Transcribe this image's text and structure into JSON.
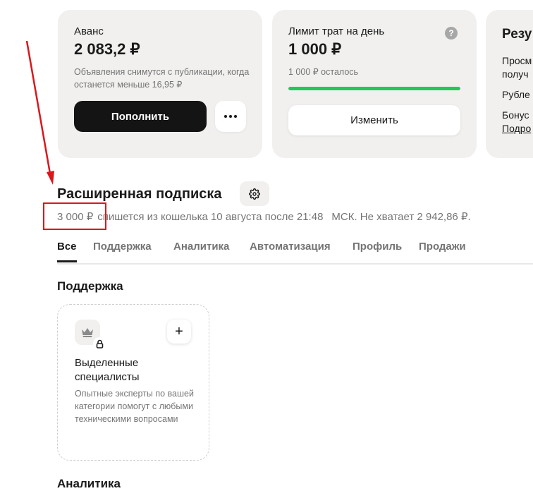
{
  "wallet": {
    "title": "Аванс",
    "amount": "2 083,2 ₽",
    "note": "Объявления снимутся с публикации, когда останется меньше 16,95 ₽",
    "topup_label": "Пополнить",
    "more_icon": "more-dots-icon"
  },
  "daily_limit": {
    "title": "Лимит трат на день",
    "amount": "1 000 ₽",
    "remaining": "1 000 ₽ осталось",
    "progress": 1.0,
    "progress_color": "#1fca55",
    "help_icon": "?",
    "change_label": "Изменить"
  },
  "results": {
    "title": "Резу",
    "line1": "Просм",
    "line2": "получ",
    "line3": "Рубле",
    "line4": "Бонус",
    "link": "Подро"
  },
  "subscription": {
    "title": "Расширенная подписка",
    "settings_icon": "gear-icon",
    "charge_amount": "3 000 ₽",
    "charge_text": "спишется из кошелька 10 августа после 21:48",
    "timezone_text": "МСК. Не хватает 2 942,86 ₽."
  },
  "tabs": [
    {
      "label": "Все",
      "active": true
    },
    {
      "label": "Поддержка",
      "active": false
    },
    {
      "label": "Аналитика",
      "active": false
    },
    {
      "label": "Автоматизация",
      "active": false
    },
    {
      "label": "Профиль",
      "active": false
    },
    {
      "label": "Продажи",
      "active": false
    }
  ],
  "groups": {
    "support_title": "Поддержка",
    "analytics_title": "Аналитика"
  },
  "feature": {
    "icon": "crown-icon",
    "lock_icon": "lock-icon",
    "add_label": "+",
    "title": "Выделенные специалисты",
    "description": "Опытные эксперты по вашей категории помогут с любыми техническими вопросами"
  },
  "colors": {
    "accent_green": "#1fca55",
    "annotation_red": "#d8181d",
    "card_bg": "#f1f0ef"
  }
}
